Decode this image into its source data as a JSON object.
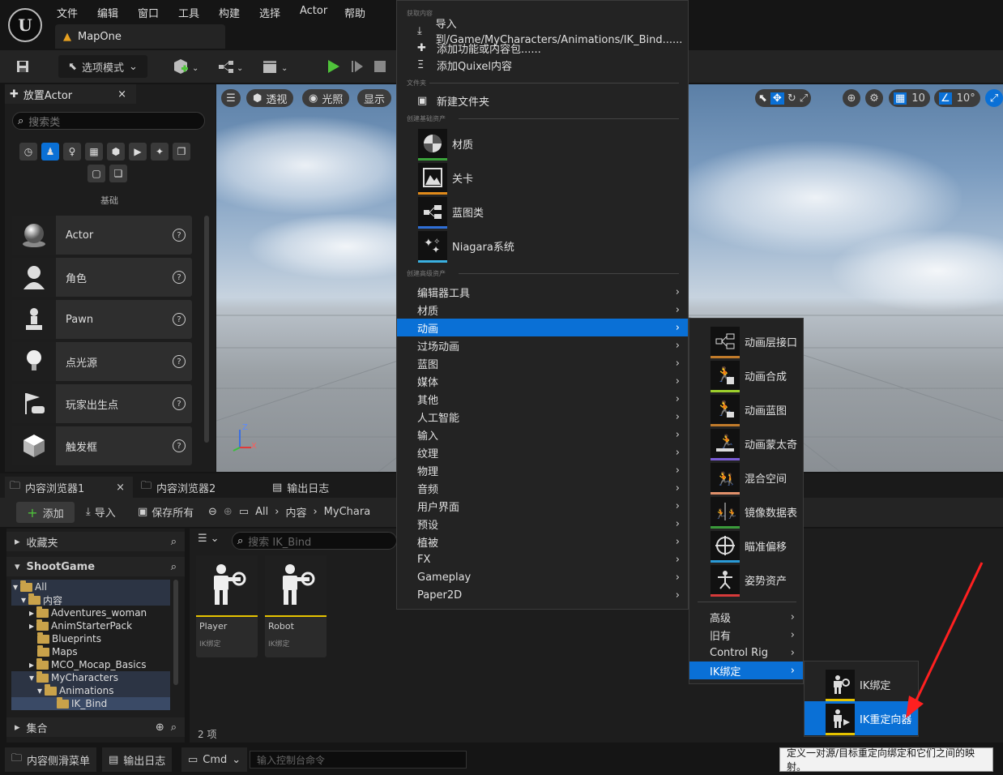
{
  "menubar": {
    "items": [
      "文件",
      "编辑",
      "窗口",
      "工具",
      "构建",
      "选择",
      "Actor",
      "帮助"
    ]
  },
  "tab": {
    "map": "MapOne"
  },
  "toolbar": {
    "mode": "选项模式"
  },
  "place_actor": {
    "title": "放置Actor",
    "search_placeholder": "搜索类",
    "section": "基础",
    "items": [
      {
        "label": "Actor"
      },
      {
        "label": "角色"
      },
      {
        "label": "Pawn"
      },
      {
        "label": "点光源"
      },
      {
        "label": "玩家出生点"
      },
      {
        "label": "触发框"
      }
    ]
  },
  "viewport": {
    "perspective": "透视",
    "lit": "光照",
    "show": "显示",
    "grid_snap": "10",
    "rot_snap": "10°",
    "axis_z": "Z",
    "axis_x": "X"
  },
  "content_tabs": {
    "cb1": "内容浏览器1",
    "cb2": "内容浏览器2",
    "log": "输出日志"
  },
  "cb_toolbar": {
    "add": "添加",
    "import": "导入",
    "save_all": "保存所有",
    "path": [
      "All",
      "内容",
      "MyChara"
    ]
  },
  "tree": {
    "favorites": "收藏夹",
    "project": "ShootGame",
    "collections": "集合",
    "items": [
      {
        "label": "All",
        "level": 0
      },
      {
        "label": "内容",
        "level": 1
      },
      {
        "label": "Adventures_woman",
        "level": 2
      },
      {
        "label": "AnimStarterPack",
        "level": 2
      },
      {
        "label": "Blueprints",
        "level": 2
      },
      {
        "label": "Maps",
        "level": 2
      },
      {
        "label": "MCO_Mocap_Basics",
        "level": 2
      },
      {
        "label": "MyCharacters",
        "level": 2
      },
      {
        "label": "Animations",
        "level": 3
      },
      {
        "label": "IK_Bind",
        "level": 4
      }
    ]
  },
  "assets": {
    "search_placeholder": "搜索 IK_Bind",
    "count": "2 项",
    "cards": [
      {
        "name": "Player",
        "type": "IK绑定"
      },
      {
        "name": "Robot",
        "type": "IK绑定"
      }
    ]
  },
  "statusbar": {
    "drawer": "内容侧滑菜单",
    "log": "输出日志",
    "cmd": "Cmd",
    "console_placeholder": "输入控制台命令"
  },
  "context_menu": {
    "sec_get": "获取内容",
    "import": "导入到/Game/MyCharacters/Animations/IK_Bind......",
    "add_feature": "添加功能或内容包......",
    "add_quixel": "添加Quixel内容",
    "sec_folder": "文件夹",
    "new_folder": "新建文件夹",
    "sec_basic": "创建基础资产",
    "basic": [
      {
        "label": "材质",
        "color": "#3aa33a"
      },
      {
        "label": "关卡",
        "color": "#e08a1a"
      },
      {
        "label": "蓝图类",
        "color": "#2f6fd6"
      },
      {
        "label": "Niagara系统",
        "color": "#3ab0e0"
      }
    ],
    "sec_adv": "创建高级资产",
    "advanced": [
      "编辑器工具",
      "材质",
      "动画",
      "过场动画",
      "蓝图",
      "媒体",
      "其他",
      "人工智能",
      "输入",
      "纹理",
      "物理",
      "音频",
      "用户界面",
      "预设",
      "植被",
      "FX",
      "Gameplay",
      "Paper2D"
    ],
    "highlight": "动画"
  },
  "anim_menu": {
    "items": [
      {
        "label": "动画层接口",
        "color": "#c07a2a"
      },
      {
        "label": "动画合成",
        "color": "#9ccf2c"
      },
      {
        "label": "动画蓝图",
        "color": "#c07a2a"
      },
      {
        "label": "动画蒙太奇",
        "color": "#7a5cd6"
      },
      {
        "label": "混合空间",
        "color": "#e0906a"
      },
      {
        "label": "镜像数据表",
        "color": "#3a9a3a"
      },
      {
        "label": "瞄准偏移",
        "color": "#2a9ad6"
      },
      {
        "label": "姿势资产",
        "color": "#d63a3a"
      }
    ],
    "more": [
      "高级",
      "旧有",
      "Control Rig",
      "IK绑定"
    ],
    "highlight": "IK绑定"
  },
  "ik_menu": {
    "items": [
      {
        "label": "IK绑定",
        "color": "#e6c300"
      },
      {
        "label": "IK重定向器",
        "color": "#e6c300"
      }
    ],
    "highlight": "IK重定向器"
  },
  "tooltip": "定义一对源/目标重定向绑定和它们之间的映射。",
  "colors": {
    "accent": "#0a70d6",
    "play": "#4fc23a",
    "select_row": "#0a70d6"
  }
}
